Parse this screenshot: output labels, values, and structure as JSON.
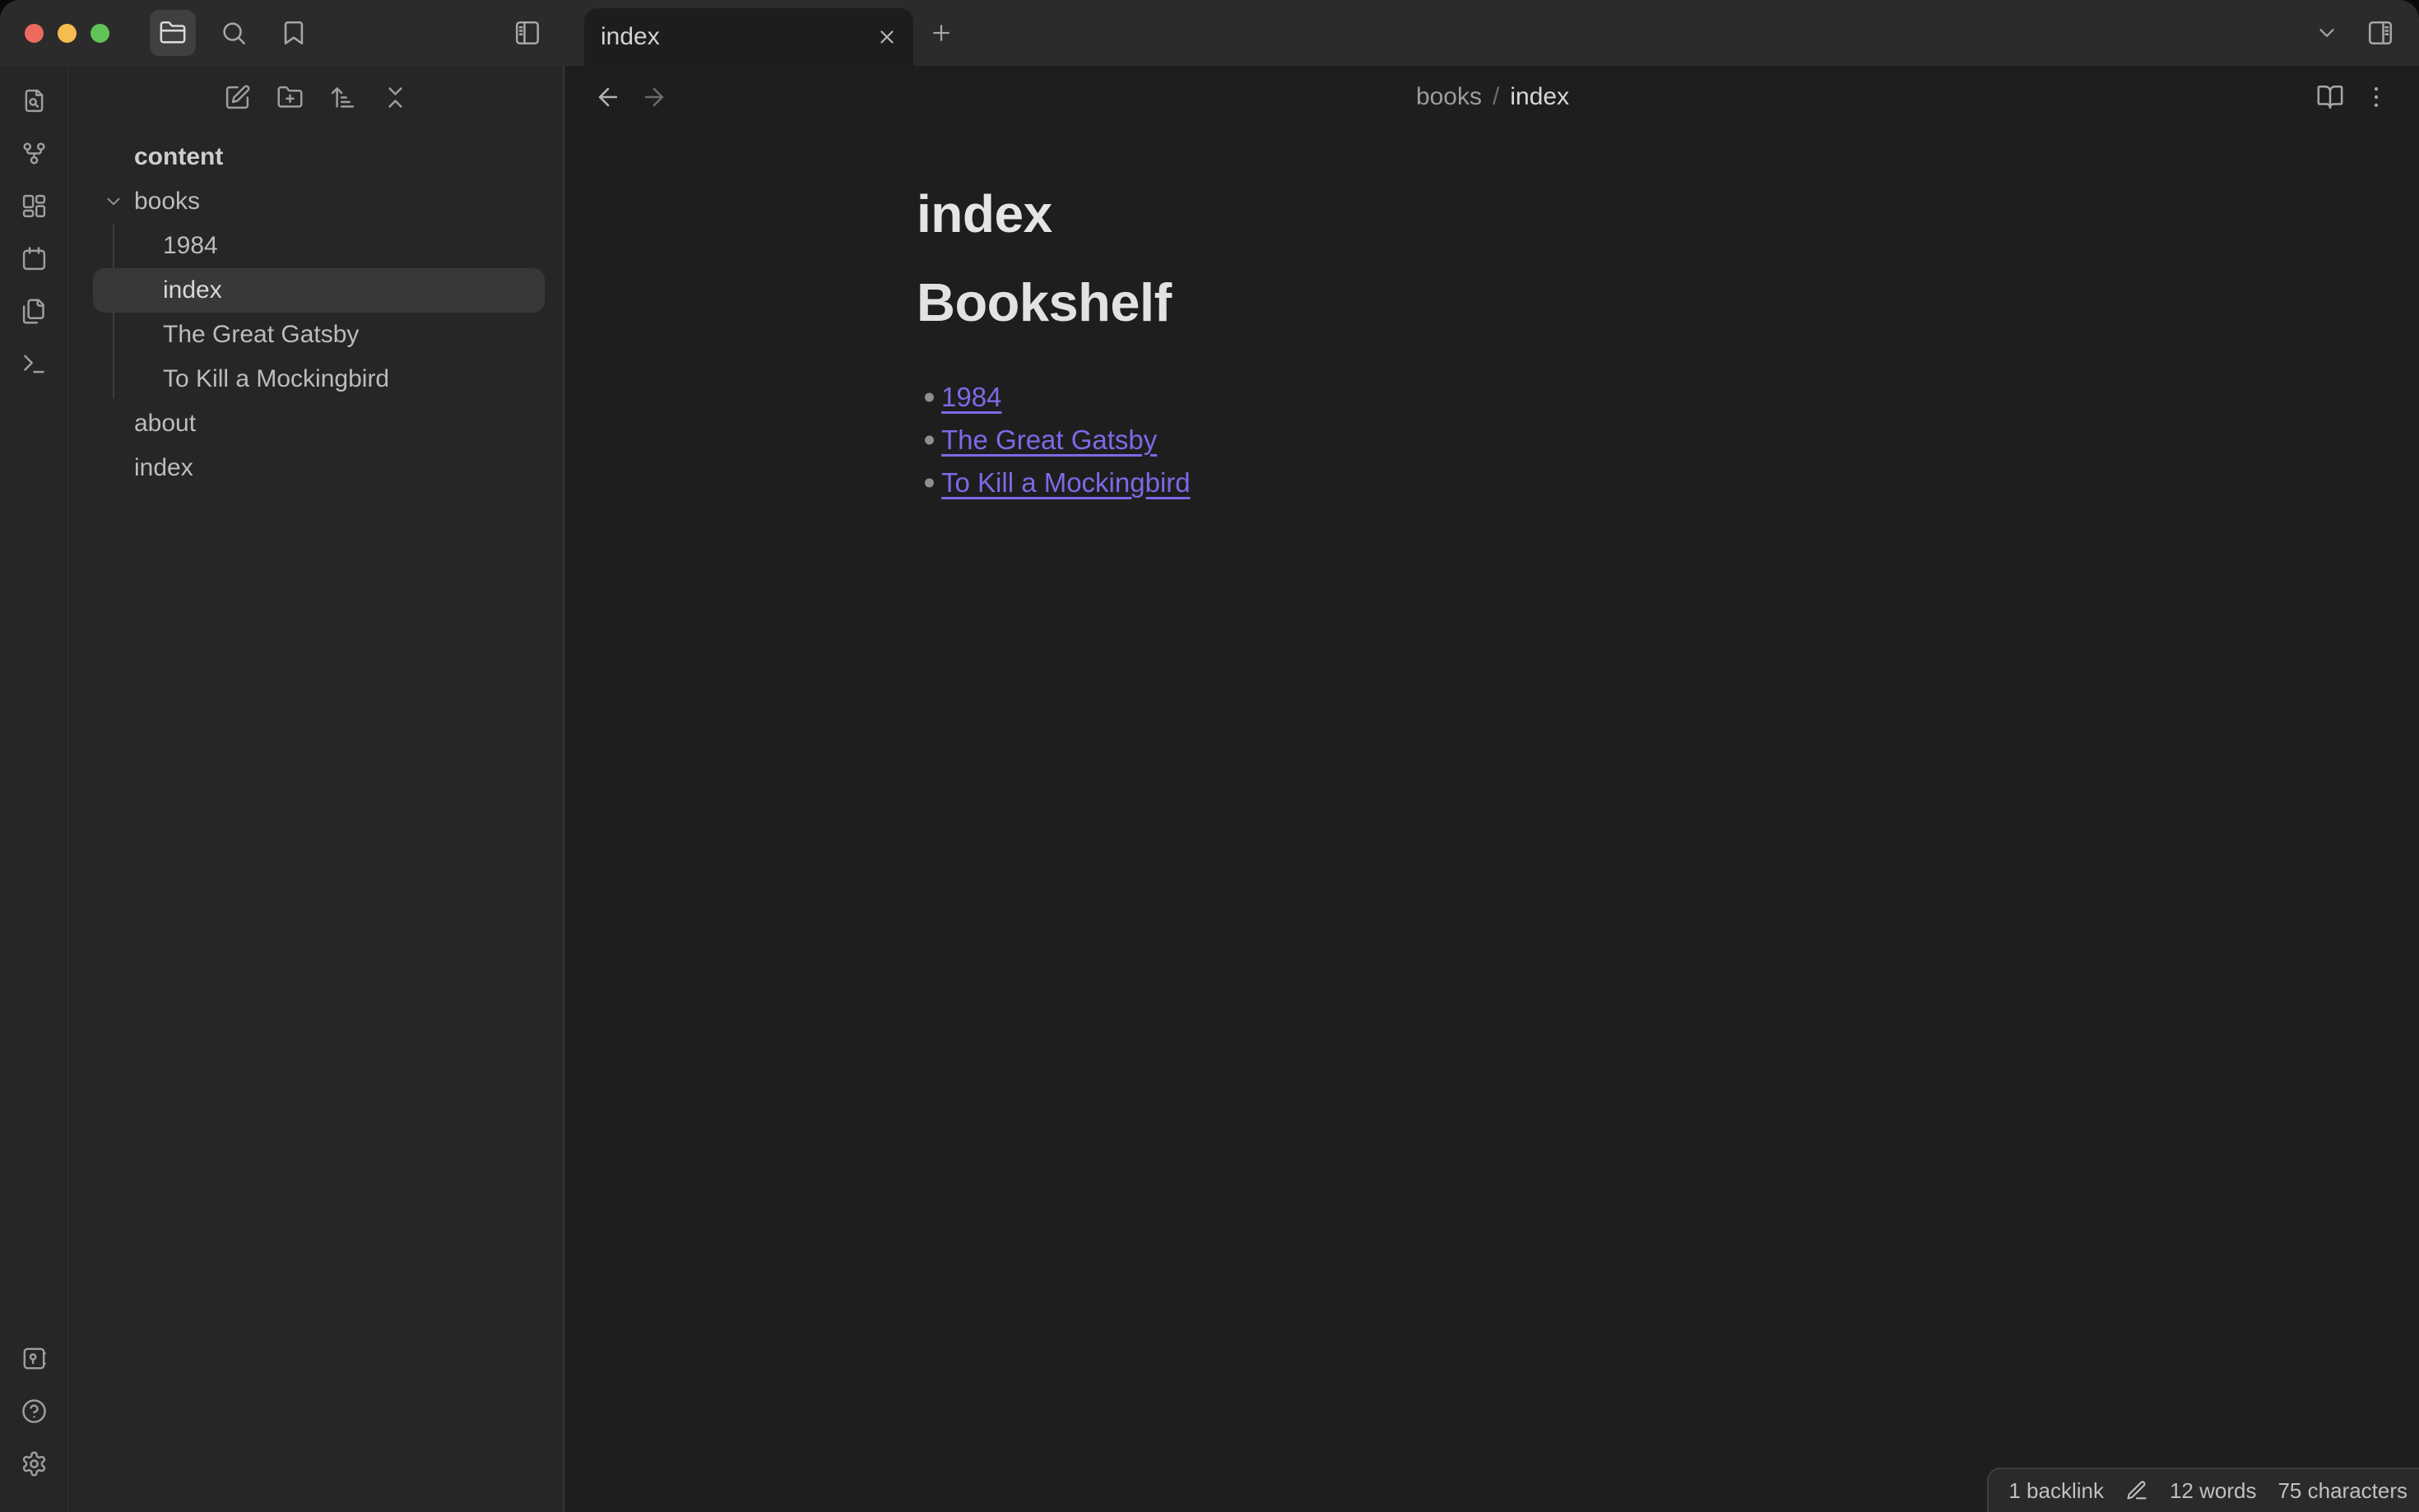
{
  "window": {
    "tab_title": "index"
  },
  "toolbar_icons": [
    "folder",
    "search",
    "bookmark",
    "panel-left",
    "tab-close",
    "new-tab",
    "tab-list-chevron",
    "panel-right"
  ],
  "ribbon_icons_top": [
    "file-search",
    "graph",
    "canvas",
    "calendar",
    "templates",
    "terminal"
  ],
  "ribbon_icons_bottom": [
    "vault",
    "help",
    "settings"
  ],
  "sidebar": {
    "header_icons": [
      "new-note",
      "new-folder",
      "sort-order",
      "collapse-all"
    ],
    "vault_name": "content",
    "folder_label": "books",
    "folder_expanded": true,
    "folder_children": [
      "1984",
      "index",
      "The Great Gatsby",
      "To Kill a Mockingbird"
    ],
    "selected_file": "index",
    "root_files": [
      "about",
      "index"
    ]
  },
  "editor": {
    "breadcrumb": {
      "parent": "books",
      "separator": "/",
      "current": "index"
    },
    "note_title": "index",
    "heading": "Bookshelf",
    "links": [
      "1984",
      "The Great Gatsby",
      "To Kill a Mockingbird"
    ]
  },
  "status_bar": {
    "backlinks": "1 backlink",
    "words": "12 words",
    "characters": "75 characters"
  },
  "colors": {
    "accent_link": "#7d69e6",
    "bg_primary": "#1e1e1e",
    "bg_secondary": "#262626",
    "bg_titlebar": "#2b2b2b",
    "selection": "#383838",
    "traffic_red": "#ee6a5f",
    "traffic_yellow": "#f5bd4f",
    "traffic_green": "#61c355"
  }
}
